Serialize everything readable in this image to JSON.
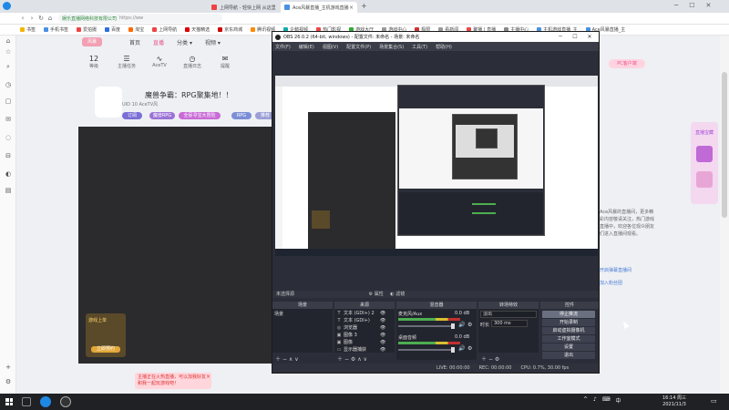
{
  "browser": {
    "tabs": [
      {
        "label": "上网导航 - 轻快上网 从这里",
        "active": false,
        "color": "#e44"
      },
      {
        "label": "Ace风暴直播_主机游戏直播",
        "active": true,
        "color": "#4a90e2"
      }
    ],
    "new_tab": "+",
    "url_secure": "娱乐直播网络科技有限公司",
    "url_text": "https://ww",
    "bookmarks": [
      {
        "label": "书签",
        "color": "#f5b400"
      },
      {
        "label": "手机书签",
        "color": "#4a90e2"
      },
      {
        "label": "爱拍摄",
        "color": "#e44"
      },
      {
        "label": "百度",
        "color": "#2f6ee0"
      },
      {
        "label": "淘宝",
        "color": "#ff6a00"
      },
      {
        "label": "上网导航",
        "color": "#e44"
      },
      {
        "label": "天猫精选",
        "color": "#d00"
      },
      {
        "label": "京东商城",
        "color": "#c00"
      },
      {
        "label": "腾讯视频",
        "color": "#ff8a00"
      },
      {
        "label": "企鹅视频",
        "color": "#1aa"
      },
      {
        "label": "热门影视",
        "color": "#e44"
      },
      {
        "label": "游戏大厅",
        "color": "#3a3"
      },
      {
        "label": "游戏中心",
        "color": "#999"
      },
      {
        "label": "极限",
        "color": "#c33"
      },
      {
        "label": "看新闻",
        "color": "#999"
      },
      {
        "label": "聚播 | 直播",
        "color": "#e44"
      },
      {
        "label": "主播中心",
        "color": "#888"
      },
      {
        "label": "主机游戏直播_主",
        "color": "#4a90e2"
      },
      {
        "label": "Ace风暴直播_主",
        "color": "#4a90e2"
      }
    ]
  },
  "sidebar_icons": [
    "home-icon",
    "star-icon",
    "search-icon",
    "clock-icon",
    "box-icon",
    "mail-icon",
    "cart-icon",
    "user-icon",
    "plus-icon",
    "gear-icon"
  ],
  "site": {
    "logo": "风暴",
    "nav": [
      {
        "label": "首页",
        "on": false
      },
      {
        "label": "直播",
        "on": true
      },
      {
        "label": "分类 ▾",
        "on": false
      },
      {
        "label": "视频 ▾",
        "on": false
      }
    ],
    "stats": [
      {
        "big": "12",
        "small": "等级"
      },
      {
        "big": "",
        "small": "主播任务"
      },
      {
        "big": "",
        "small": "AceTV"
      },
      {
        "big": "",
        "small": "直播日志"
      },
      {
        "big": "",
        "small": "提醒"
      }
    ],
    "room_title": "魔兽争霸：RPG聚集地！！",
    "room_meta": "UID 10 AceTV风",
    "pills": [
      "订阅",
      "魔兽RPG",
      "全民寻宝大冒险",
      "RPG",
      "推荐"
    ],
    "pc_button": "PC客户端",
    "promo_label": "游戏上单",
    "promo_button": "立即预约",
    "toast": "主播正在火热直播，可以加我好友和我一起玩游戏吧！",
    "right_text": "Ace风暴的直播间，更多精彩内容敬请关注，热门游戏直播中，欢迎各位观众朋友们进入直播间观看。",
    "right_links": [
      "开启弹幕直播间",
      "加入粉丝团"
    ],
    "gift_label": "直播宝藏"
  },
  "obs": {
    "title": "OBS 26.0.2 (64-bit, windows) - 配置文件: 未命名 - 场景: 未命名",
    "window_buttons": [
      "─",
      "☐",
      "✕"
    ],
    "menu": [
      "文件(F)",
      "编辑(E)",
      "视图(V)",
      "配置文件(P)",
      "场景集合(S)",
      "工具(T)",
      "帮助(H)"
    ],
    "status_line": "未选择源",
    "status_props": "属性",
    "status_filters": "滤镜",
    "docks": {
      "scenes": "场景",
      "sources": "来源",
      "mixer": "混音器",
      "transitions": "转场特效",
      "controls": "控件"
    },
    "scene_list": [
      "场景"
    ],
    "sources": [
      {
        "icon": "T",
        "name": "文本 (GDI+) 2"
      },
      {
        "icon": "T",
        "name": "文本 (GDI+)"
      },
      {
        "icon": "◎",
        "name": "浏览器"
      },
      {
        "icon": "▣",
        "name": "图像 3"
      },
      {
        "icon": "▣",
        "name": "图像"
      },
      {
        "icon": "▭",
        "name": "显示器捕获"
      }
    ],
    "mixer": [
      {
        "name": "麦克风/Aux",
        "db": "0.0 dB"
      },
      {
        "name": "桌面音频",
        "db": "0.0 dB"
      }
    ],
    "transition": {
      "value": "淡出",
      "duration_label": "时长",
      "duration": "300 ms"
    },
    "controls": [
      "停止推流",
      "开始录制",
      "启动虚拟摄像机",
      "工作室模式",
      "设置",
      "退出"
    ],
    "footer": {
      "live": "LIVE: 00:00:00",
      "rec": "REC: 00:00:00",
      "cpu": "CPU: 0.7%, 30.00 fps"
    }
  },
  "taskbar": {
    "tray": [
      "^",
      "♪",
      "⌨",
      "中"
    ],
    "time": "16:14 周三",
    "date": "2021/11/3"
  }
}
